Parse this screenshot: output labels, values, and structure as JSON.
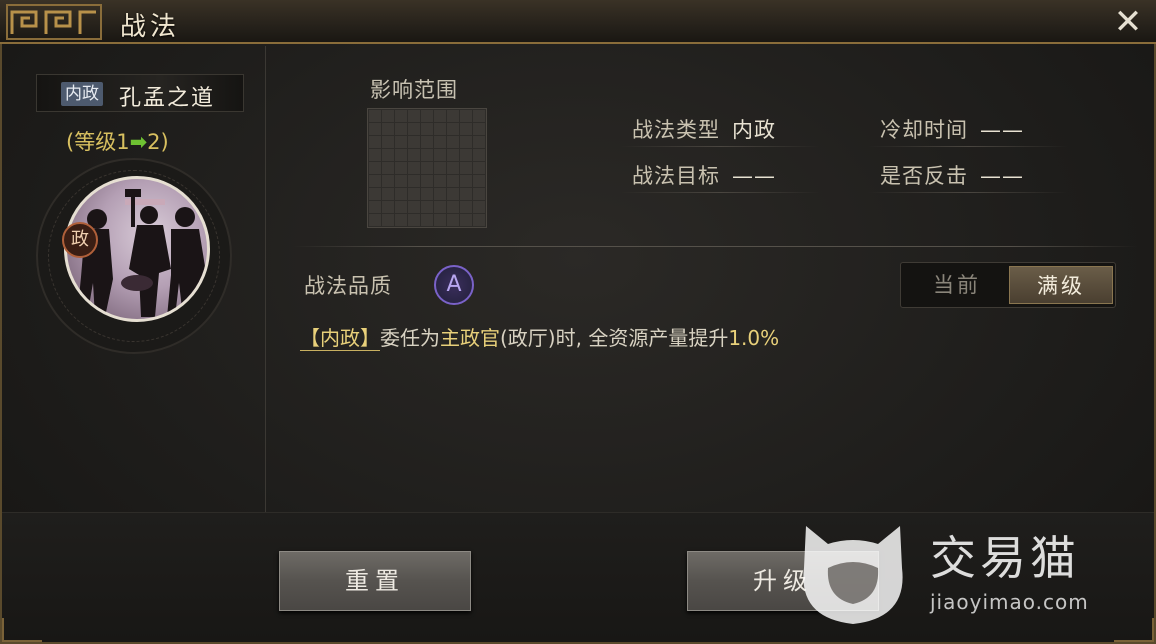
{
  "window": {
    "title": "战法",
    "close_icon": "close-icon"
  },
  "skill": {
    "type_tag": "内政",
    "name": "孔孟之道",
    "level_prefix": "(等级1",
    "level_arrow": "➡",
    "level_suffix": "2)",
    "portrait_badge": "政"
  },
  "range": {
    "label": "影响范围"
  },
  "attributes": {
    "type_label": "战法类型",
    "type_value": "内政",
    "target_label": "战法目标",
    "target_value": "——",
    "cooldown_label": "冷却时间",
    "cooldown_value": "——",
    "counter_label": "是否反击",
    "counter_value": "——"
  },
  "quality": {
    "label": "战法品质",
    "grade": "A"
  },
  "toggle": {
    "current": "当前",
    "max": "满级",
    "selected": "max"
  },
  "description": {
    "tag": "【内政】",
    "part1": "委任为",
    "highlight1": "主政官",
    "part2": "(政厅)时, 全资源产量提升",
    "highlight2": "1.0%"
  },
  "buttons": {
    "reset": "重置",
    "upgrade": "升级"
  },
  "watermark": {
    "brand": "交易猫",
    "url": "jiaoyimao.com"
  },
  "colors": {
    "gold_text": "#e8d07a",
    "level_text": "#d8c060",
    "arrow_green": "#6ec232",
    "quality_purple": "#7a62c8",
    "frame_gold": "#8a6d3a"
  }
}
